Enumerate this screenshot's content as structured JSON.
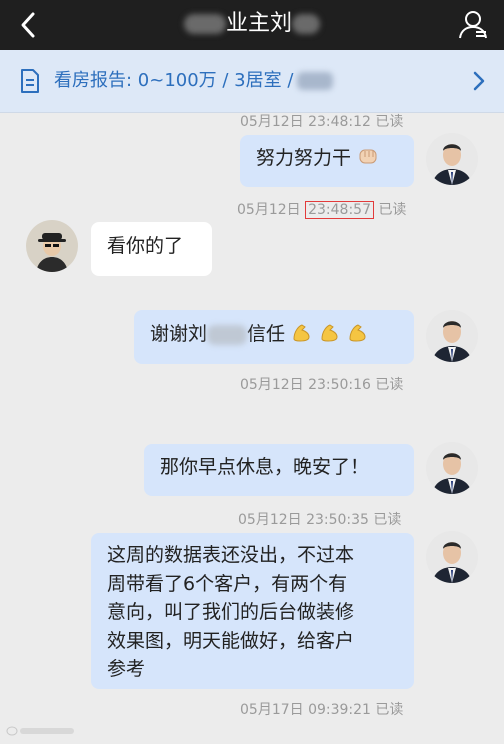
{
  "header": {
    "title_left": "",
    "title_main": "业主刘"
  },
  "report": {
    "text": "看房报告: 0~100万 / 3居室 /"
  },
  "messages": [
    {
      "type": "ts",
      "text": "05月12日 23:48:12 已读"
    },
    {
      "type": "sent",
      "text": "努力努力干"
    },
    {
      "type": "ts",
      "date": "05月12日",
      "time": "23:48:57",
      "status": "已读"
    },
    {
      "type": "recv",
      "text": "看你的了"
    },
    {
      "type": "sent",
      "text_a": "谢谢刘",
      "text_b": "信任"
    },
    {
      "type": "ts",
      "text": "05月12日 23:50:16 已读"
    },
    {
      "type": "sent",
      "text": "那你早点休息，晚安了！"
    },
    {
      "type": "ts",
      "text": "05月12日 23:50:35 已读"
    },
    {
      "type": "sent",
      "lines": [
        "这周的数据表还没出，不过本",
        "周带看了6个客户，有两个有",
        "意向，叫了我们的后台做装修",
        "效果图，明天能做好，给客户",
        "参考"
      ]
    },
    {
      "type": "ts",
      "text": "05月17日 09:39:21 已读"
    }
  ],
  "colors": {
    "sent_bubble": "#d6e5fb",
    "recv_bubble": "#ffffff",
    "accent": "#2d6fbd",
    "topbar": "#1f1f1f"
  }
}
